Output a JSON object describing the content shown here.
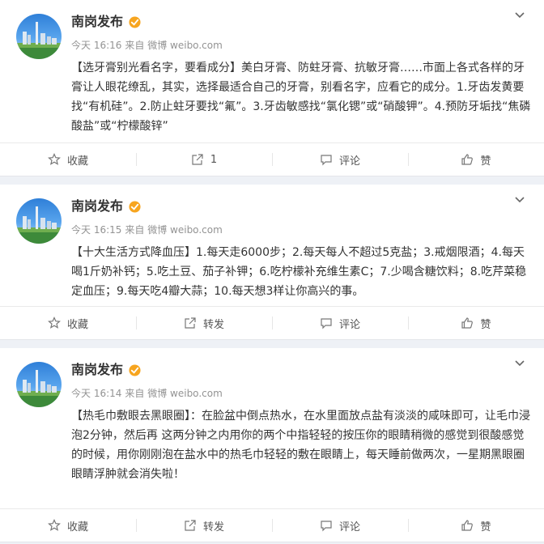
{
  "posts": [
    {
      "author": "南岗发布",
      "time": "今天 16:16",
      "source": "来自 微博 weibo.com",
      "content": "【选牙膏别光看名字，要看成分】美白牙膏、防蛀牙膏、抗敏牙膏……市面上各式各样的牙膏让人眼花缭乱，其实，选择最适合自己的牙膏，别看名字，应看它的成分。1.牙齿发黄要找“有机硅”。2.防止蛀牙要找“氟”。3.牙齿敏感找“氯化锶”或“硝酸钾”。4.预防牙垢找“焦磷酸盐”或“柠檬酸锌”",
      "actions": {
        "collect": "收藏",
        "repost": "1",
        "comment": "评论",
        "like": "赞"
      }
    },
    {
      "author": "南岗发布",
      "time": "今天 16:15",
      "source": "来自 微博 weibo.com",
      "content": "【十大生活方式降血压】1.每天走6000步；2.每天每人不超过5克盐；3.戒烟限酒；4.每天喝1斤奶补钙；5.吃土豆、茄子补钾；6.吃柠檬补充维生素C；7.少喝含糖饮料；8.吃芹菜稳定血压；9.每天吃4瓣大蒜；10.每天想3样让你高兴的事。",
      "actions": {
        "collect": "收藏",
        "repost": "转发",
        "comment": "评论",
        "like": "赞"
      }
    },
    {
      "author": "南岗发布",
      "time": "今天 16:14",
      "source": "来自 微博 weibo.com",
      "content": "【热毛巾敷眼去黑眼圈】：在脸盆中倒点热水，在水里面放点盐有淡淡的咸味即可，让毛巾浸泡2分钟，然后再 这两分钟之内用你的两个中指轻轻的按压你的眼睛稍微的感觉到很酸感觉的时候，用你刚刚泡在盐水中的热毛巾轻轻的敷在眼睛上，每天睡前做两次，一星期黑眼圈眼睛浮肿就会消失啦！",
      "actions": {
        "collect": "收藏",
        "repost": "转发",
        "comment": "评论",
        "like": "赞"
      }
    }
  ],
  "colors": {
    "verified": "#f7a51f",
    "background": "#eef1f6",
    "meta": "#939393"
  }
}
